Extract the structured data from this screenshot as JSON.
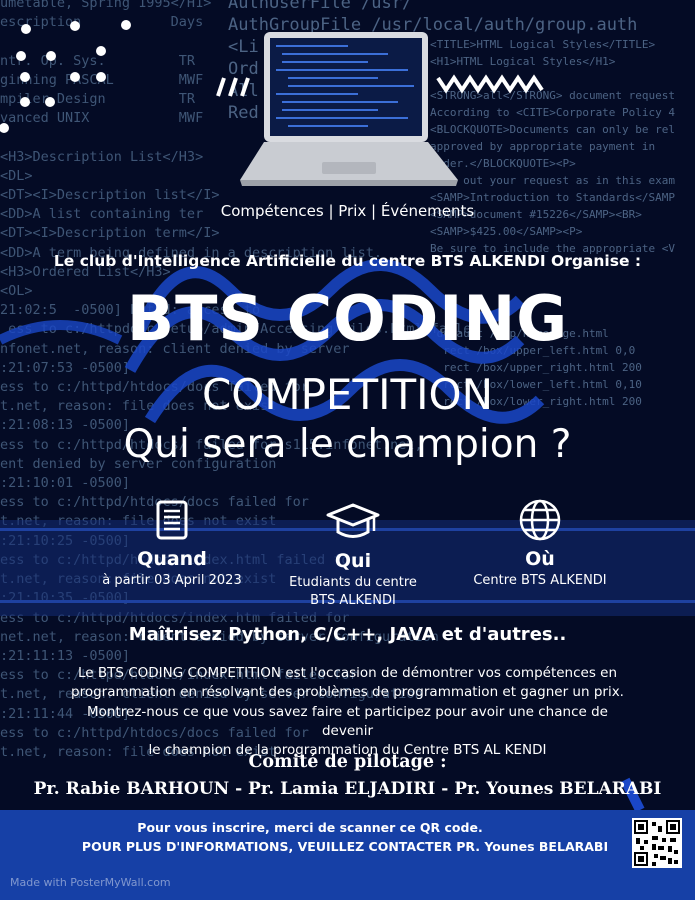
{
  "poster": {
    "tagline": "Compétences | Prix | Événements",
    "organiser": "Le club d'Intelligence Artificielle du centre BTS ALKENDI Organise :",
    "title": "BTS CODING",
    "subtitle": "COMPETITION",
    "slogan": "Qui sera le champion ?"
  },
  "info": {
    "when": {
      "heading": "Quand",
      "text": "à partir 03 April 2023",
      "icon": "document-icon"
    },
    "who": {
      "heading": "Qui",
      "text_line1": "Etudiants du centre",
      "text_line2": "BTS ALKENDI",
      "icon": "graduation-cap-icon"
    },
    "where": {
      "heading": "Où",
      "text": "Centre BTS ALKENDI",
      "icon": "globe-icon"
    }
  },
  "languages": "Maîtrisez Python, C/C++, JAVA et d'autres..",
  "description": {
    "line1": "Le BTS CODING COMPETITION est l'occasion de démontrer vos compétences en",
    "line2": "programmation en résolvant des problèmes de programmation et gagner un prix.",
    "line3": "Montrez-nous ce que vous savez faire et participez pour avoir une chance de devenir",
    "line4": "le champion de la programmation du Centre BTS AL KENDI"
  },
  "committee": {
    "heading": "Comité de pilotage :",
    "members": "Pr. Rabie BARHOUN  -  Pr. Lamia ELJADIRI  -  Pr. Younes BELARABI"
  },
  "footer": {
    "line1": "Pour vous inscrire, merci de scanner ce QR code.",
    "line2": "POUR PLUS D'INFORMATIONS, VEUILLEZ CONTACTER PR. Younes BELARABI",
    "watermark": "Made with PosterMyWall.com"
  },
  "background_code": {
    "top": "AuthUserFile /usr/\nAuthGroupFile /usr/local/auth/group.auth\n<Li\nOrd\nAll\nRed",
    "left": "umetable, Spring 1995</H1>\nescription           Days\n\nntr. Op. Sys.         TR\nginning PASCAL        MWF\nmpiler Design         TR\nvanced UNIX           MWF\n\n<H3>Description List</H3>\n<DL>\n<DT><I>Description list</I>\n<DD>A list containing ter\n<DT><I>Description term</I>\n<DD>A term being defined in a description list.\n<H3>Ordered List</H3>\n<OL>\n21:02:5  -0500] httpd: access to\n ess to c:/httpddoc/setup/admin/Accessing files.html failed\nnfonet.net, reason: client denied by server\n:21:07:53 -0500]\ness to c:/httpd/htdocs/docs failed for\nt.net, reason: file does not exist\n:21:08:13 -0500]\ness to c:/httpd/htdocs/ failed for s115.infonet.net,\nent denied by server configuration\n:21:10:01 -0500]\ness to c:/httpd/htdocs/docs failed for\nt.net, reason: file does not exist\n:21:10:25 -0500]\ness to c:/httpd/htdocs/index.html failed for\nt.net, reason: file does not exist\n:21:10:35 -0500]\ness to c:/httpd/htdocs/index.htm failed for\nnet.net, reason: client denied by server configuration\n:21:11:13 -0500]\ness to c:/httpd/htdocs/index.html failed for\nt.net, reason: client denied by server configuration\n:21:11:44 -0500]\ness to c:/httpd/htdocs/docs failed for\nt.net, reason: file does not exist",
    "right": "<TITLE>HTML Logical Styles</TITLE>\n<H1>HTML Logical Styles</H1>\n\n<STRONG>all</STRONG> document request\nAccording to <CITE>Corporate Policy 4\n<BLOCKQUOTE>Documents can only be rel\napproved by appropriate payment in\norder.</BLOCKQUOTE><P>\nfill out your request as in this exam\n<SAMP>Introduction to Standards</SAMP\n<SAMP>document #15226</SAMP><BR>\n<SAMP>$425.00</SAMP><P>\nBe sure to include the appropriate <V\n\n\n\n\n default /top/homepage.html\n  rect /box/upper_left.html 0,0\n  rect /box/upper_right.html 200\n  rect /box/lower_left.html 0,10\n  rect /box/lower_right.html 200"
  }
}
